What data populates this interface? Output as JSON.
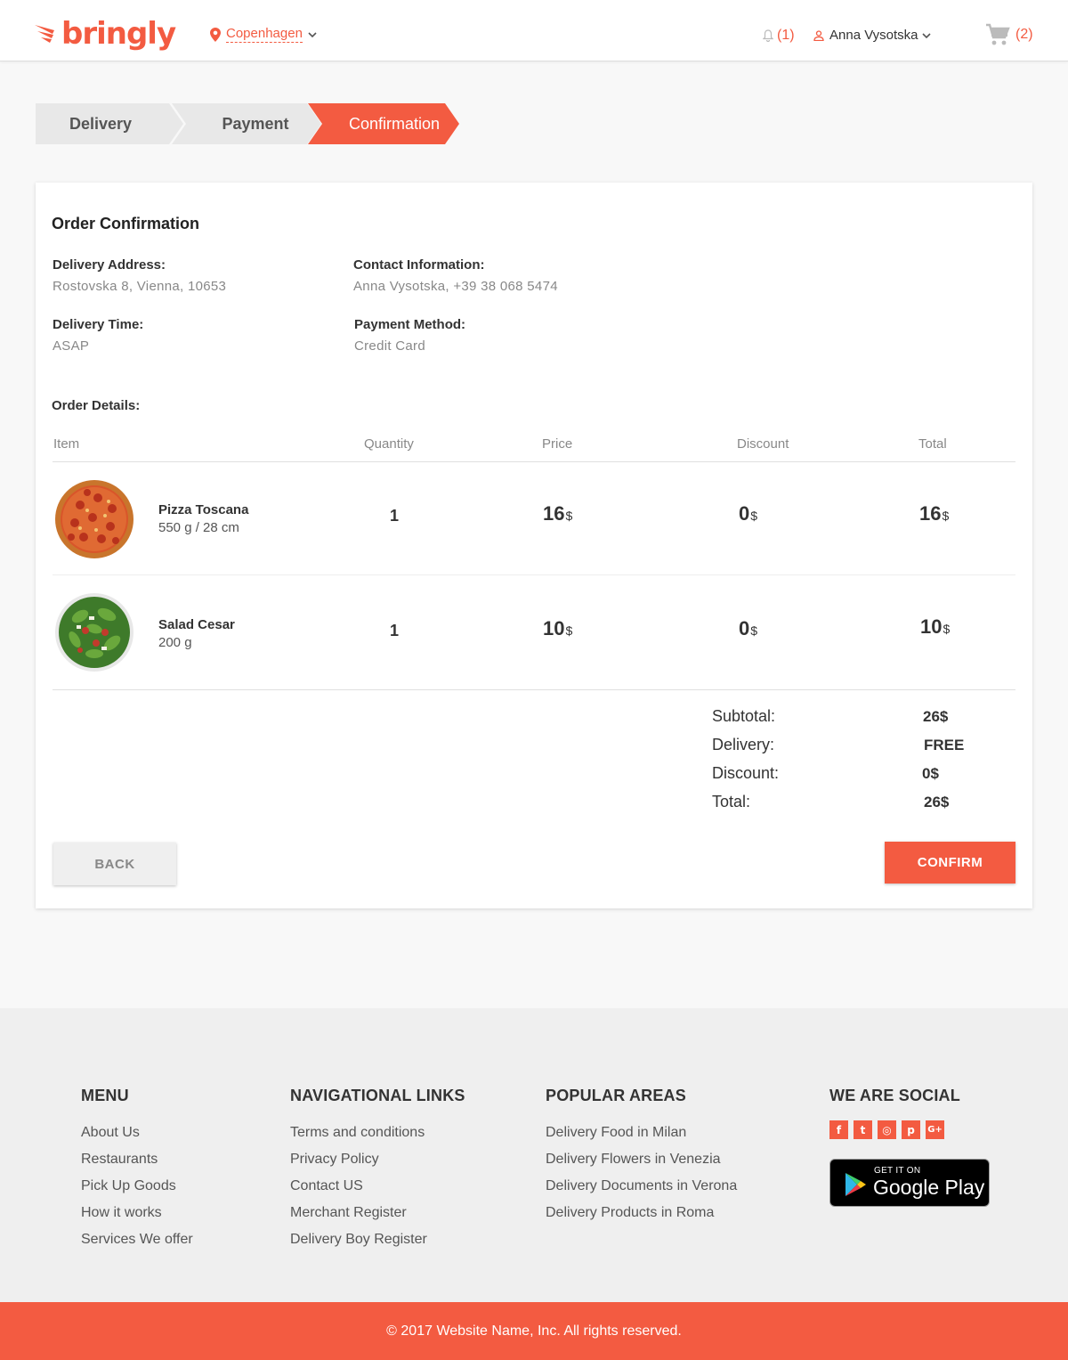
{
  "header": {
    "logo": "bringly",
    "city": "Copenhagen",
    "notifications": "(1)",
    "user": "Anna Vysotska",
    "cart": "(2)"
  },
  "steps": [
    "Delivery",
    "Payment",
    "Confirmation"
  ],
  "order": {
    "title": "Order Confirmation",
    "delivery_address_label": "Delivery Address:",
    "delivery_address": "Rostovska 8, Vienna, 10653",
    "contact_label": "Contact Information:",
    "contact": "Anna Vysotska, +39 38 068 5474",
    "delivery_time_label": "Delivery Time:",
    "delivery_time": "ASAP",
    "payment_label": "Payment Method:",
    "payment": "Credit Card",
    "details_label": "Order Details:",
    "columns": [
      "Item",
      "Quantity",
      "Price",
      "Discount",
      "Total"
    ],
    "items": [
      {
        "name": "Pizza Toscana",
        "sub": "550 g / 28 cm",
        "qty": "1",
        "price": "16",
        "discount": "0",
        "total": "16",
        "image": "pizza"
      },
      {
        "name": "Salad Cesar",
        "sub": "200 g",
        "qty": "1",
        "price": "10",
        "discount": "0",
        "total": "10",
        "image": "salad"
      }
    ],
    "currency": "$",
    "summary": {
      "subtotal_label": "Subtotal:",
      "subtotal": "26$",
      "delivery_label": "Delivery:",
      "delivery": "FREE",
      "discount_label": "Discount:",
      "discount": "0$",
      "total_label": "Total:",
      "total": "26$"
    },
    "back_button": "BACK",
    "confirm_button": "CONFIRM"
  },
  "footer": {
    "menu_title": "MENU",
    "menu": [
      "About Us",
      "Restaurants",
      "Pick Up Goods",
      "How it works",
      "Services We offer"
    ],
    "nav_title": "NAVIGATIONAL LINKS",
    "nav": [
      "Terms and conditions",
      "Privacy Policy",
      "Contact US",
      "Merchant Register",
      "Delivery Boy Register"
    ],
    "areas_title": "POPULAR AREAS",
    "areas": [
      "Delivery Food in Milan",
      "Delivery Flowers in Venezia",
      "Delivery Documents in Verona",
      "Delivery Products in Roma"
    ],
    "social_title": "WE ARE SOCIAL",
    "social_icons": [
      "facebook-icon",
      "twitter-icon",
      "instagram-icon",
      "pinterest-icon",
      "google-plus-icon"
    ],
    "gplay_small": "GET IT ON",
    "gplay_big": "Google Play",
    "copyright": "© 2017 Website Name, Inc. All rights reserved."
  },
  "colors": {
    "accent": "#f35b41",
    "page_bg": "#f8f8f8",
    "footer_bg": "#efefef"
  }
}
